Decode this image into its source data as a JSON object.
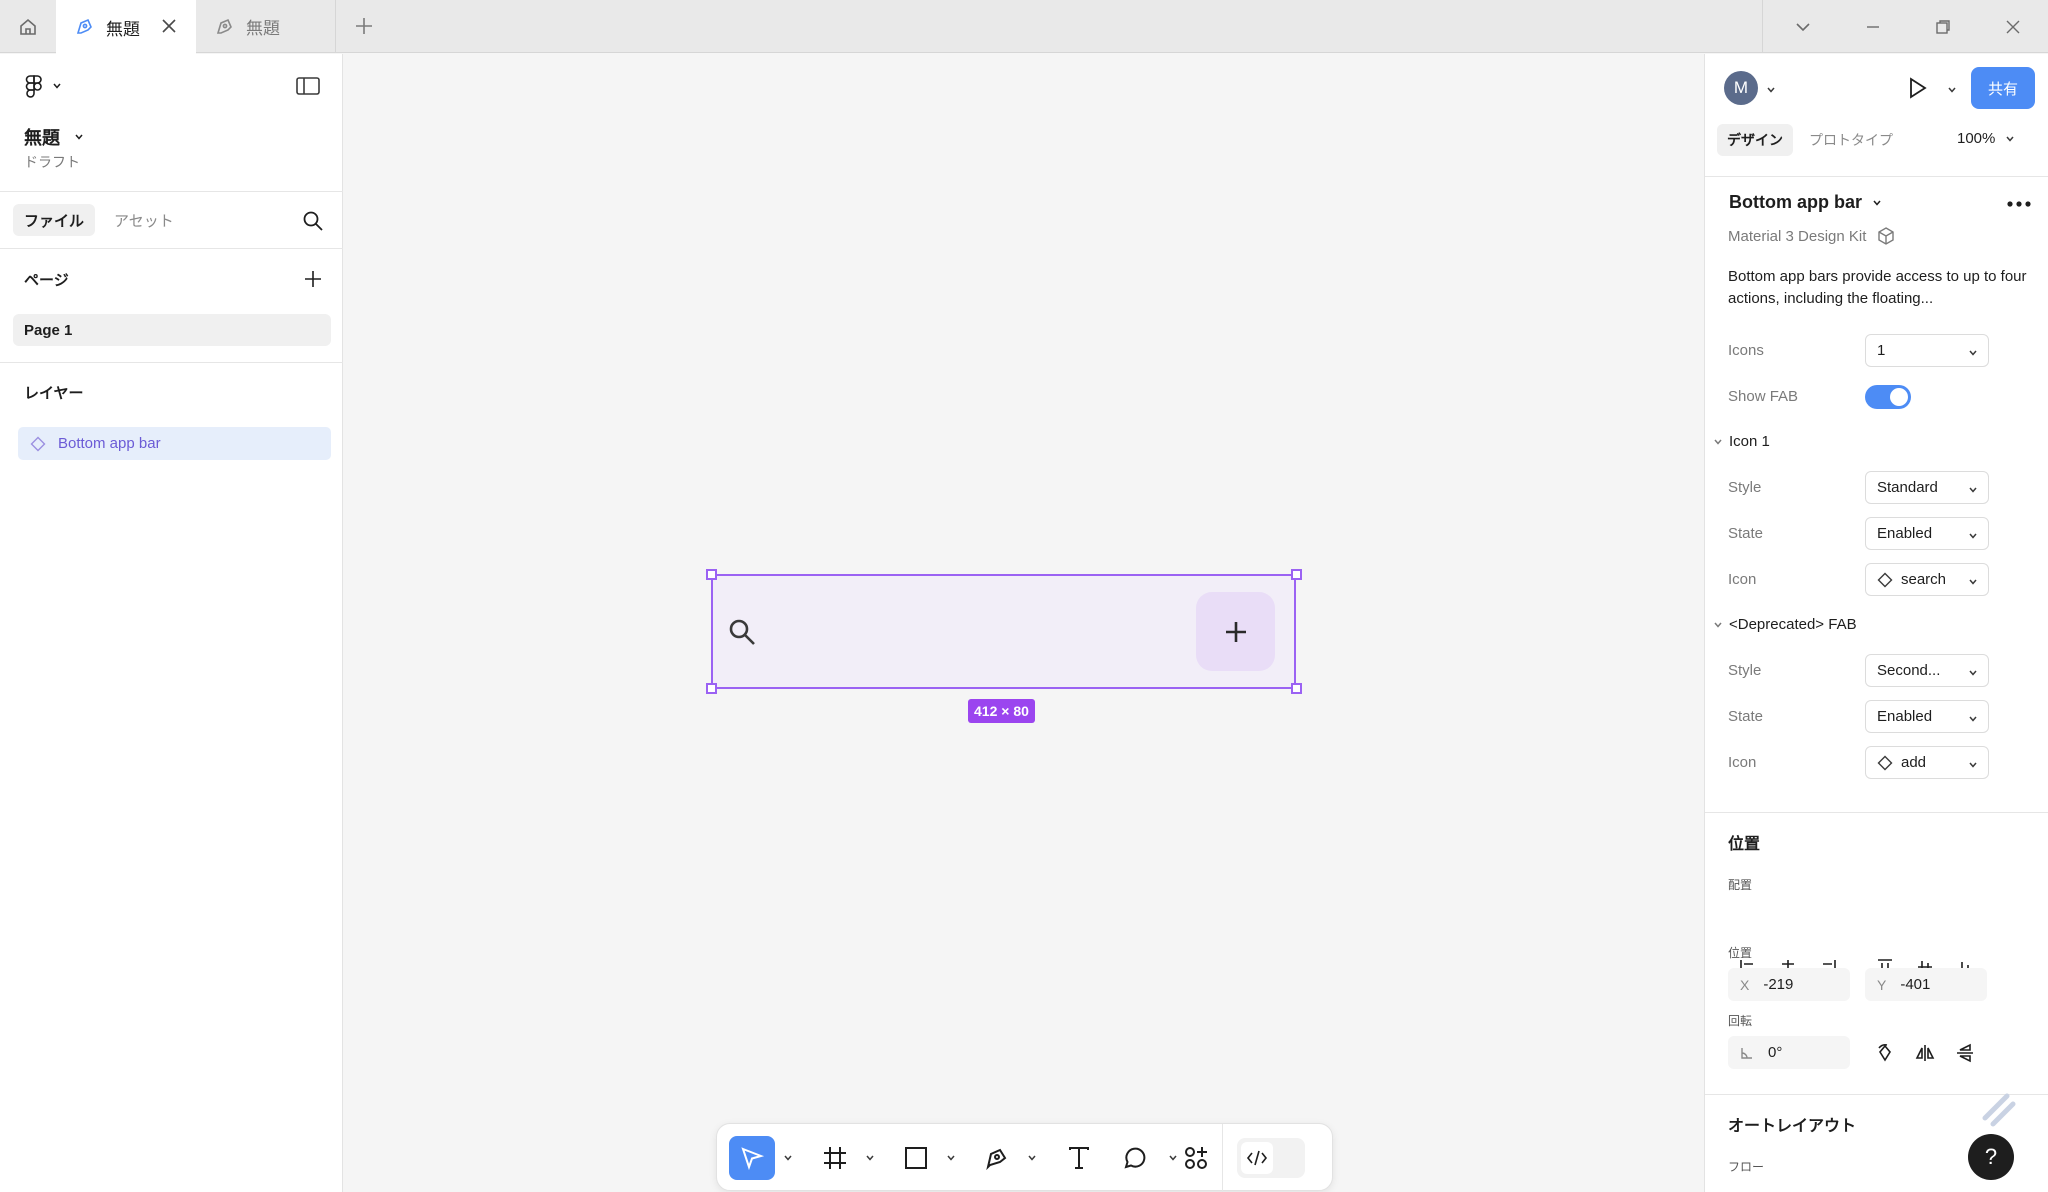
{
  "tabs": [
    {
      "label": "無題",
      "active": true
    },
    {
      "label": "無題",
      "active": false
    }
  ],
  "file": {
    "title": "無題",
    "subtitle": "ドラフト"
  },
  "left_panel": {
    "tabs": [
      "ファイル",
      "アセット"
    ],
    "pages_label": "ページ",
    "pages": [
      "Page 1"
    ],
    "layers_label": "レイヤー",
    "layers": [
      "Bottom app bar"
    ]
  },
  "canvas": {
    "selection_size": "412 × 80"
  },
  "right_panel": {
    "avatar_initial": "M",
    "share_label": "共有",
    "tabs": [
      "デザイン",
      "プロトタイプ"
    ],
    "zoom": "100%",
    "component": {
      "name": "Bottom app bar",
      "library": "Material 3 Design Kit",
      "description": "Bottom app bars provide access to up to four actions, including the floating..."
    },
    "props": {
      "icons_label": "Icons",
      "icons_value": "1",
      "show_fab_label": "Show FAB",
      "icon1_group": "Icon 1",
      "style_label": "Style",
      "style_value": "Standard",
      "state_label": "State",
      "state_value": "Enabled",
      "icon_label": "Icon",
      "icon_value": "search",
      "fab_group": "<Deprecated> FAB",
      "fab_style_value": "Second...",
      "fab_state_value": "Enabled",
      "fab_icon_value": "add"
    },
    "position": {
      "section": "位置",
      "align_label": "配置",
      "pos_label": "位置",
      "x_prefix": "X",
      "x": "-219",
      "y_prefix": "Y",
      "y": "-401",
      "rotation_label": "回転",
      "rotation": "0°"
    },
    "autolayout": {
      "section": "オートレイアウト",
      "flow_label": "フロー"
    },
    "help": "?"
  },
  "colors": {
    "accent": "#4d8cf5",
    "selection": "#9b62f3",
    "badge": "#9b45ef"
  }
}
